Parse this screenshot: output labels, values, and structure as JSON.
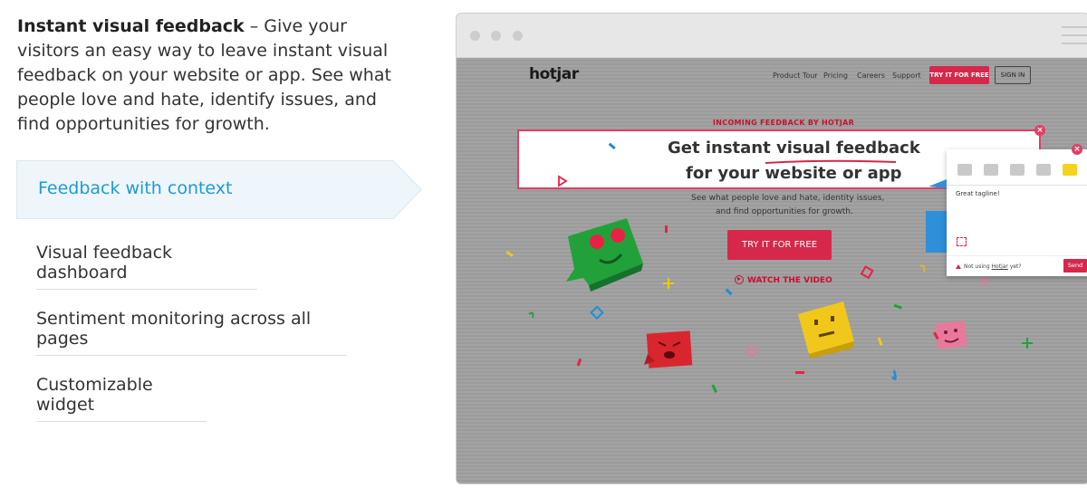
{
  "intro": {
    "bold": "Instant visual feedback",
    "text": " – Give your visitors an easy way to leave instant visual feedback on your website or app. See what people love and hate, identify issues, and find opportunities for growth."
  },
  "features": [
    {
      "label": "Feedback with context",
      "active": true
    },
    {
      "label": "Visual feedback dashboard",
      "active": false
    },
    {
      "label": "Sentiment monitoring across all pages",
      "active": false
    },
    {
      "label": "Customizable widget",
      "active": false
    }
  ],
  "site": {
    "logo": "hotjar",
    "nav": [
      "Product Tour",
      "Pricing",
      "Careers",
      "Support"
    ],
    "try_top": "TRY IT FOR FREE",
    "signin": "SIGN IN",
    "incoming": "INCOMING FEEDBACK BY HOTJAR",
    "headline_1": "Get instant visual feedback",
    "headline_2": "for your website or app",
    "sub_1": "See what people love and hate, identity issues,",
    "sub_2": "and find opportunities for growth.",
    "try_main": "TRY IT FOR FREE",
    "watch": "WATCH THE VIDEO"
  },
  "widget": {
    "comment": "Great tagline!",
    "not_using_prefix": "Not using ",
    "not_using_link": "Hotjar",
    "not_using_suffix": " yet?",
    "send": "Send",
    "close": "×"
  },
  "colors": {
    "accent_blue": "#1e9ad6",
    "brand_red": "#d6284a",
    "highlight_pink": "#e23e64",
    "active_bg": "#eef6fb"
  }
}
